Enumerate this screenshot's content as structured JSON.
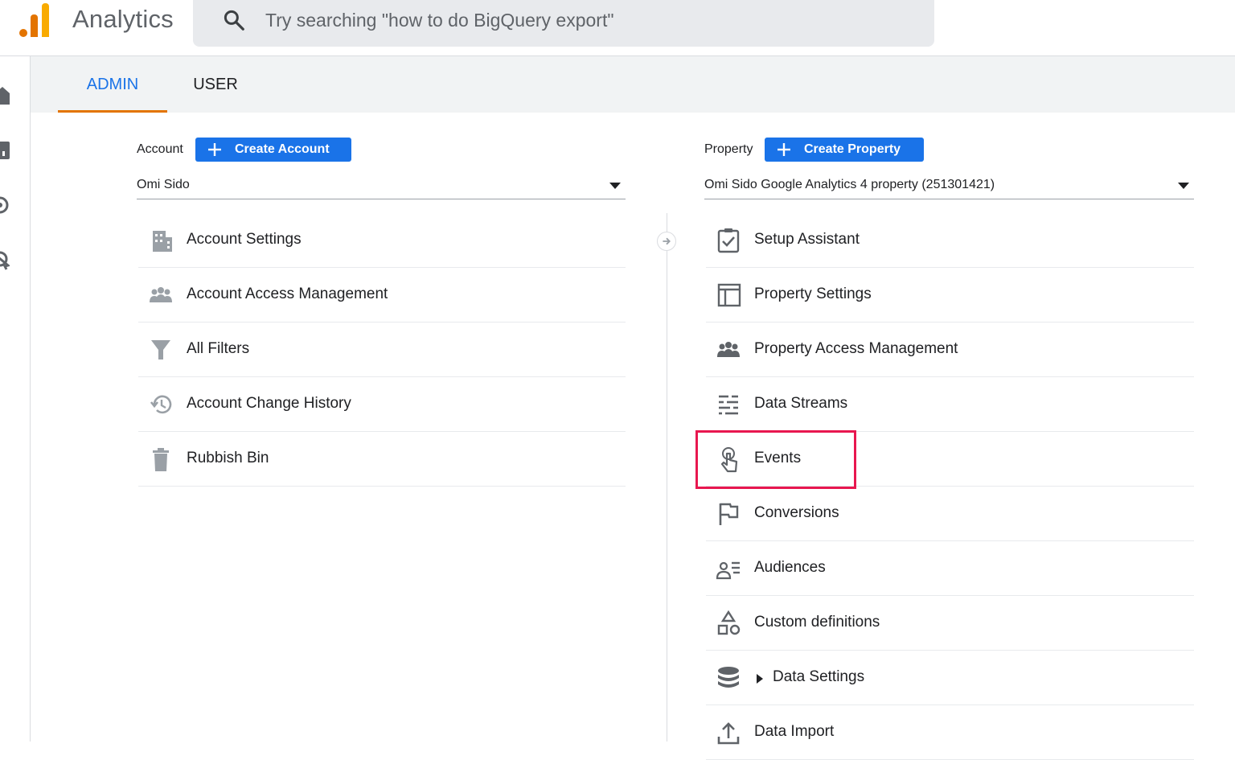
{
  "app": {
    "title": "Analytics",
    "brand_colors": {
      "orange": "#e37400",
      "yellow": "#f9ab00",
      "accent_blue": "#1a73e8",
      "highlight_red": "#e8174f"
    }
  },
  "search": {
    "placeholder": "Try searching \"how to do BigQuery export\"",
    "icon": "search-icon"
  },
  "left_nav": {
    "icons": [
      "home-icon",
      "reports-icon",
      "explore-icon",
      "advertising-icon"
    ]
  },
  "tabs": [
    {
      "label": "ADMIN",
      "active": true
    },
    {
      "label": "USER",
      "active": false
    }
  ],
  "account": {
    "label": "Account",
    "create_label": "Create Account",
    "selected": "Omi Sido",
    "items": [
      {
        "label": "Account Settings",
        "icon": "building-icon"
      },
      {
        "label": "Account Access Management",
        "icon": "people-icon"
      },
      {
        "label": "All Filters",
        "icon": "filter-icon"
      },
      {
        "label": "Account Change History",
        "icon": "history-icon"
      },
      {
        "label": "Rubbish Bin",
        "icon": "trash-icon"
      }
    ]
  },
  "property": {
    "label": "Property",
    "create_label": "Create Property",
    "selected": "Omi Sido Google Analytics 4 property (251301421)",
    "items": [
      {
        "label": "Setup Assistant",
        "icon": "checklist-icon"
      },
      {
        "label": "Property Settings",
        "icon": "window-icon"
      },
      {
        "label": "Property Access Management",
        "icon": "people-icon"
      },
      {
        "label": "Data Streams",
        "icon": "streams-icon"
      },
      {
        "label": "Events",
        "icon": "touch-icon",
        "highlighted": true
      },
      {
        "label": "Conversions",
        "icon": "flag-icon"
      },
      {
        "label": "Audiences",
        "icon": "audience-icon"
      },
      {
        "label": "Custom definitions",
        "icon": "shapes-icon"
      },
      {
        "label": "Data Settings",
        "icon": "database-icon",
        "expandable": true
      },
      {
        "label": "Data Import",
        "icon": "upload-icon"
      }
    ]
  }
}
